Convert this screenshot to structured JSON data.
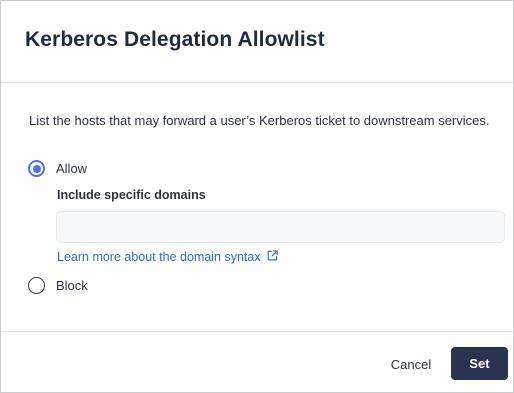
{
  "dialog": {
    "title": "Kerberos Delegation Allowlist",
    "description": "List the hosts that may forward a user’s Kerberos ticket to downstream services.",
    "options": {
      "allow": {
        "label": "Allow",
        "selected": true
      },
      "block": {
        "label": "Block",
        "selected": false
      }
    },
    "domains_field": {
      "label": "Include specific domains",
      "value": "",
      "placeholder": ""
    },
    "help_link": {
      "label": "Learn more about the domain syntax",
      "icon": "external-link-icon"
    },
    "footer": {
      "cancel_label": "Cancel",
      "set_label": "Set"
    }
  },
  "colors": {
    "accent": "#4f6df5",
    "link": "#2f6fc4",
    "primary_button": "#2a3450",
    "title": "#1f2a44"
  }
}
